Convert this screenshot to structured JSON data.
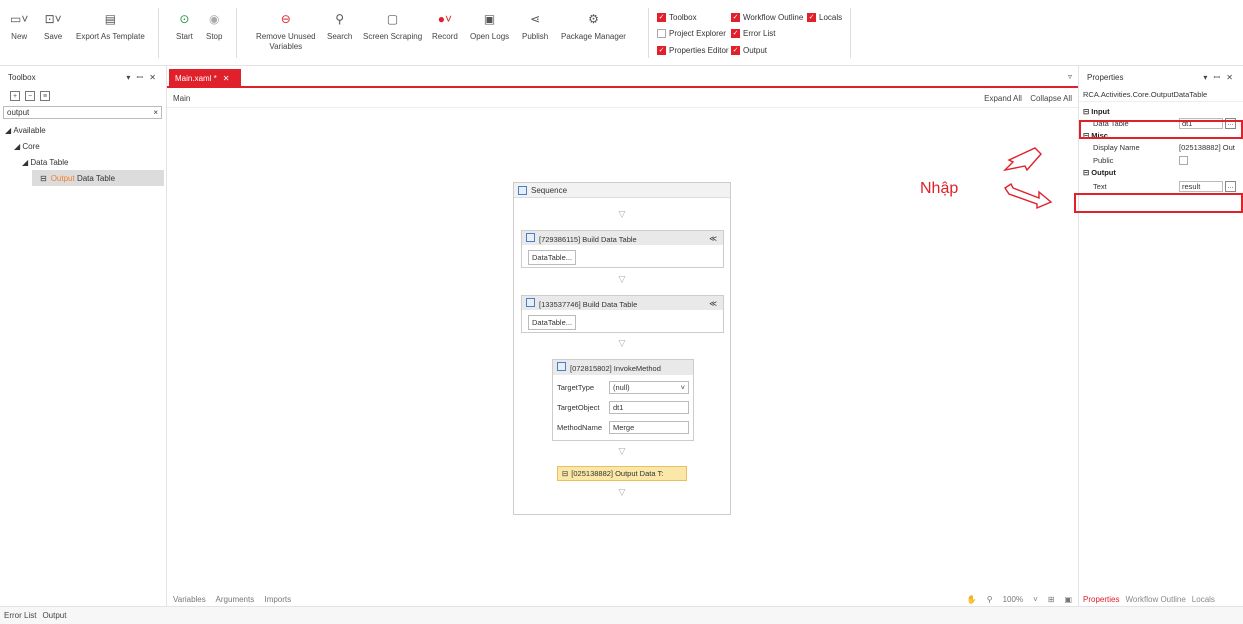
{
  "ribbon": {
    "new": "New",
    "save": "Save",
    "export": "Export As Template",
    "start": "Start",
    "stop": "Stop",
    "remove_unused_1": "Remove Unused",
    "remove_unused_2": "Variables",
    "search": "Search",
    "screen_scraping": "Screen Scraping",
    "record": "Record",
    "open_logs": "Open Logs",
    "publish": "Publish",
    "package_manager": "Package Manager",
    "checks": {
      "toolbox": "Toolbox",
      "workflow_outline": "Workflow Outline",
      "locals": "Locals",
      "project_explorer": "Project Explorer",
      "error_list": "Error List",
      "properties_editor": "Properties Editor",
      "output": "Output"
    }
  },
  "toolbox": {
    "title": "Toolbox",
    "controls": "▾ ꟷ ✕",
    "search_value": "output",
    "search_clear": "×",
    "tree": {
      "available": "Available",
      "core": "Core",
      "data_table": "Data Table",
      "item_highlight": "Output",
      "item_rest": " Data Table"
    }
  },
  "document": {
    "tab_label": "Main.xaml *",
    "tab_close": "✕",
    "tab_menu": "▿",
    "breadcrumb": "Main",
    "expand_all": "Expand All",
    "collapse_all": "Collapse All"
  },
  "workflow": {
    "sequence": "Sequence",
    "build1": "[729386115] Build Data Table",
    "build1_btn": "DataTable...",
    "build2": "[133537746] Build Data Table",
    "build2_btn": "DataTable...",
    "invoke": "[072815802] InvokeMethod",
    "target_type_label": "TargetType",
    "target_type_value": "(null)",
    "target_object_label": "TargetObject",
    "target_object_value": "dt1",
    "method_name_label": "MethodName",
    "method_name_value": "Merge",
    "output_dt": "[025138882] Output Data T:"
  },
  "canvas_bottom": {
    "variables": "Variables",
    "arguments": "Arguments",
    "imports": "Imports",
    "zoom": "100%"
  },
  "properties": {
    "title": "Properties",
    "controls": "▾ ꟷ ✕",
    "type": "RCA.Activities.Core.OutputDataTable",
    "cat_input": "Input",
    "data_table_label": "Data Table",
    "data_table_value": "dt1",
    "cat_misc": "Misc",
    "display_name_label": "Display Name",
    "display_name_value": "[025138882] Out",
    "public_label": "Public",
    "cat_output": "Output",
    "text_label": "Text",
    "text_value": "result",
    "dots": "...",
    "tabs": {
      "properties": "Properties",
      "workflow_outline": "Workflow Outline",
      "locals": "Locals"
    }
  },
  "annotation": {
    "text": "Nhập"
  },
  "statusbar": {
    "error_list": "Error List",
    "output": "Output"
  },
  "colors": {
    "accent": "#e0202a",
    "highlight": "#fbe8a8",
    "orange": "#f08030"
  }
}
